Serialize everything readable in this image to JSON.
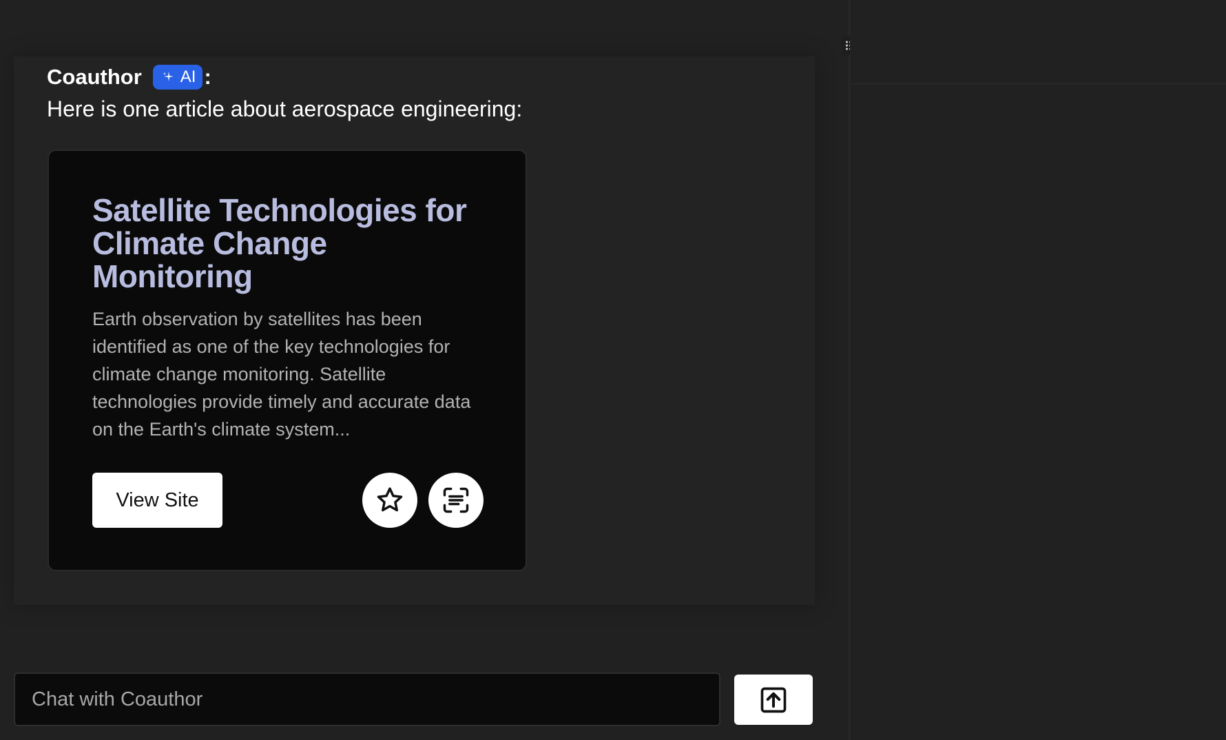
{
  "message": {
    "sender": "Coauthor",
    "badge_label": "AI",
    "separator": ":",
    "text": "Here is one article about aerospace engineering:"
  },
  "article": {
    "title": "Satellite Technologies for Climate Change Monitoring",
    "summary": "Earth observation by satellites has been identified as one of the key technologies for climate change monitoring. Satellite technologies provide timely and accurate data on the Earth's climate system...",
    "view_button_label": "View Site",
    "icons": [
      "star-icon",
      "text-scan-icon"
    ]
  },
  "composer": {
    "placeholder": "Chat with Coauthor",
    "value": "",
    "send_icon": "arrow-up-square-icon"
  },
  "colors": {
    "background": "#212121",
    "accent": "#2962e6",
    "title": "#b8bcdf",
    "card": "#0a0a0a"
  }
}
